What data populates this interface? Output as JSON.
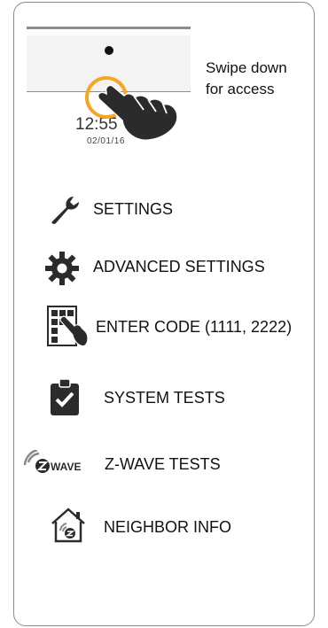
{
  "device_preview": {
    "time": "12:55",
    "date": "02/01/16"
  },
  "hint": {
    "line1": "Swipe down",
    "line2": "for access"
  },
  "menu": [
    {
      "label": "SETTINGS",
      "icon": "wrench-icon"
    },
    {
      "label": "ADVANCED SETTINGS",
      "icon": "gear-icon"
    },
    {
      "label": "ENTER CODE (1111, 2222)",
      "icon": "keypad-hand-icon"
    },
    {
      "label": "SYSTEM TESTS",
      "icon": "clipboard-check-icon"
    },
    {
      "label": "Z-WAVE TESTS",
      "icon": "zwave-logo-icon"
    },
    {
      "label": "NEIGHBOR INFO",
      "icon": "home-network-icon"
    }
  ],
  "colors": {
    "accent_ring": "#f5a623",
    "icon_dark": "#2b2b2b",
    "border": "#8a8a8a"
  }
}
